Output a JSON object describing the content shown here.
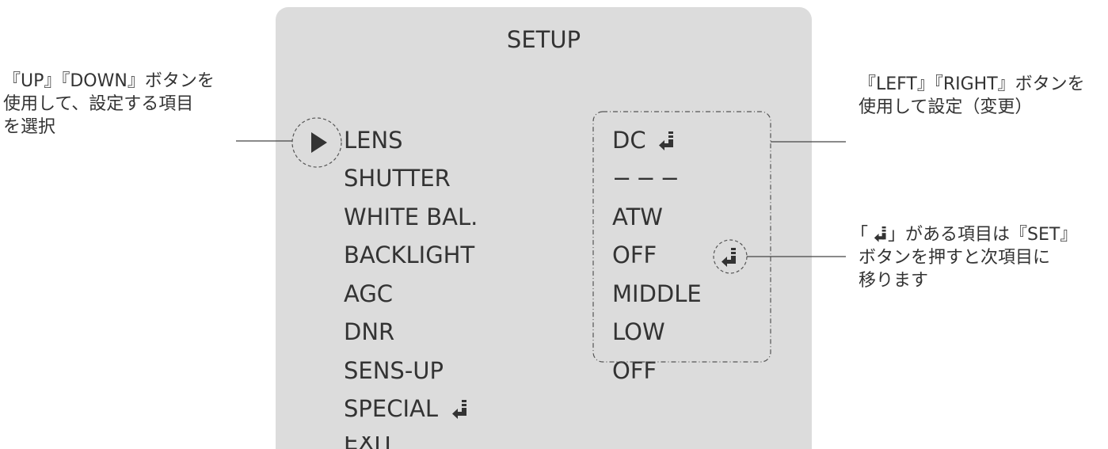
{
  "menu": {
    "title": "SETUP",
    "items": [
      "LENS",
      "SHUTTER",
      "WHITE BAL.",
      "BACKLIGHT",
      "AGC",
      "DNR",
      "SENS-UP",
      "SPECIAL",
      "EXIT"
    ],
    "values": [
      "DC",
      "−−−",
      "ATW",
      "OFF",
      "MIDDLE",
      "LOW",
      "OFF"
    ]
  },
  "annotations": {
    "left": [
      "『UP』『DOWN』ボタンを",
      "使用して、設定する項目",
      "を選択"
    ],
    "right_top": [
      "『LEFT』『RIGHT』ボタンを",
      "使用して設定（変更）"
    ],
    "right_bottom_open": "「",
    "right_bottom_rest": "」がある項目は『SET』",
    "right_bottom_lines": [
      "ボタンを押すと次項目に",
      "移ります"
    ]
  },
  "icons": [
    "cursor-arrow-icon",
    "enter-icon"
  ],
  "colors": {
    "panel": "#dcdcdc",
    "text": "#333333"
  }
}
